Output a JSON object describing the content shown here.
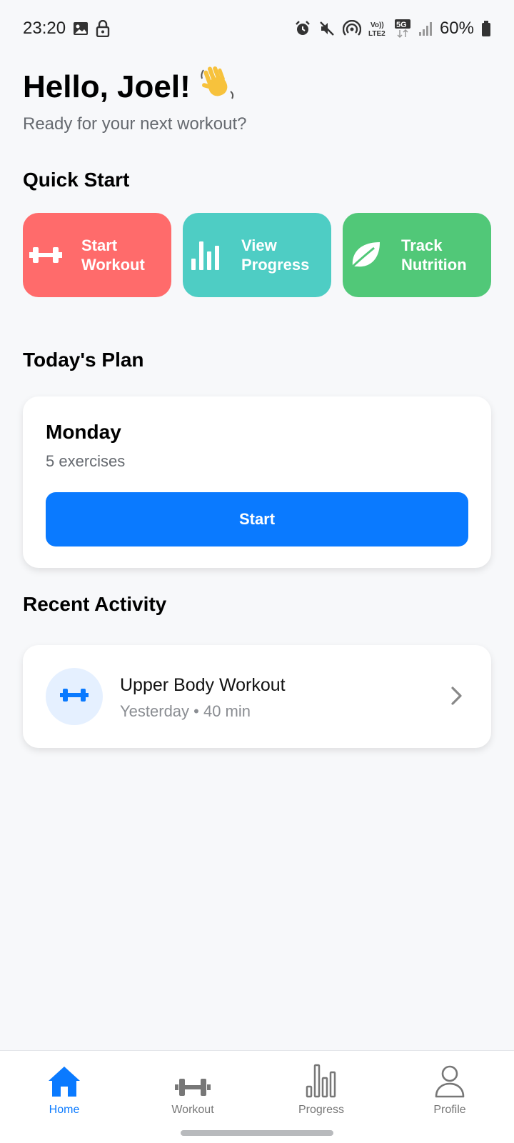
{
  "status_bar": {
    "time": "23:20",
    "battery": "60%",
    "left_icons": [
      "image-icon",
      "lock-icon"
    ],
    "right_icons": [
      "alarm-icon",
      "mute-icon",
      "hotspot-icon",
      "volte-icon",
      "5g-icon",
      "signal-icon",
      "battery-icon"
    ]
  },
  "header": {
    "greeting": "Hello, Joel!",
    "subtitle": "Ready for your next workout?"
  },
  "quick_start": {
    "title": "Quick Start",
    "cards": [
      {
        "label": "Start\nWorkout",
        "icon": "dumbbell-icon",
        "color": "#ff6b6b"
      },
      {
        "label": "View\nProgress",
        "icon": "bar-chart-icon",
        "color": "#4ecdc4"
      },
      {
        "label": "Track\nNutrition",
        "icon": "leaf-icon",
        "color": "#51c878"
      }
    ]
  },
  "todays_plan": {
    "title": "Today's Plan",
    "day": "Monday",
    "exercises": "5 exercises",
    "button": "Start"
  },
  "recent_activity": {
    "title": "Recent Activity",
    "items": [
      {
        "title": "Upper Body Workout",
        "meta": "Yesterday • 40 min",
        "icon": "dumbbell-icon"
      }
    ]
  },
  "bottom_nav": {
    "items": [
      {
        "label": "Home",
        "icon": "home-icon",
        "active": true
      },
      {
        "label": "Workout",
        "icon": "dumbbell-icon",
        "active": false
      },
      {
        "label": "Progress",
        "icon": "bar-chart-icon",
        "active": false
      },
      {
        "label": "Profile",
        "icon": "user-icon",
        "active": false
      }
    ]
  },
  "colors": {
    "accent": "#0a7aff",
    "background": "#f7f8fa"
  }
}
